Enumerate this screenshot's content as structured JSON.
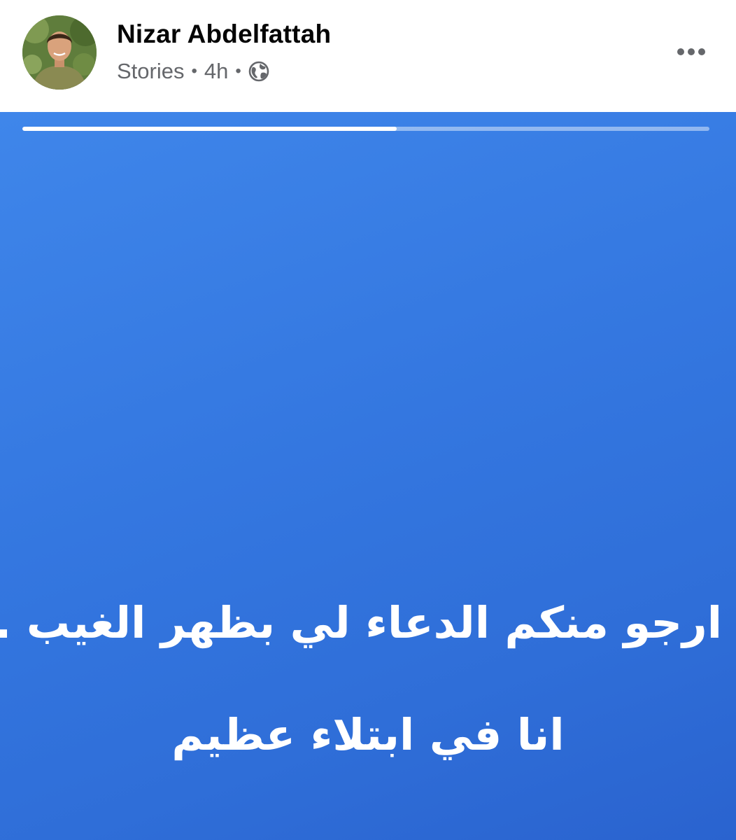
{
  "header": {
    "author_name": "Nizar Abdelfattah",
    "source_label": "Stories",
    "separator": "•",
    "time_ago": "4h",
    "privacy_icon": "globe-icon",
    "more_icon": "more-horizontal-icon"
  },
  "story": {
    "progress_fraction": 0.545,
    "lines": [
      "ارجو منكم الدعاء لي بظهر الغيب ...",
      "انا في ابتلاء عظيم"
    ],
    "background_colors": [
      "#3f86ea",
      "#2a63cf"
    ],
    "text_color": "#ffffff"
  }
}
